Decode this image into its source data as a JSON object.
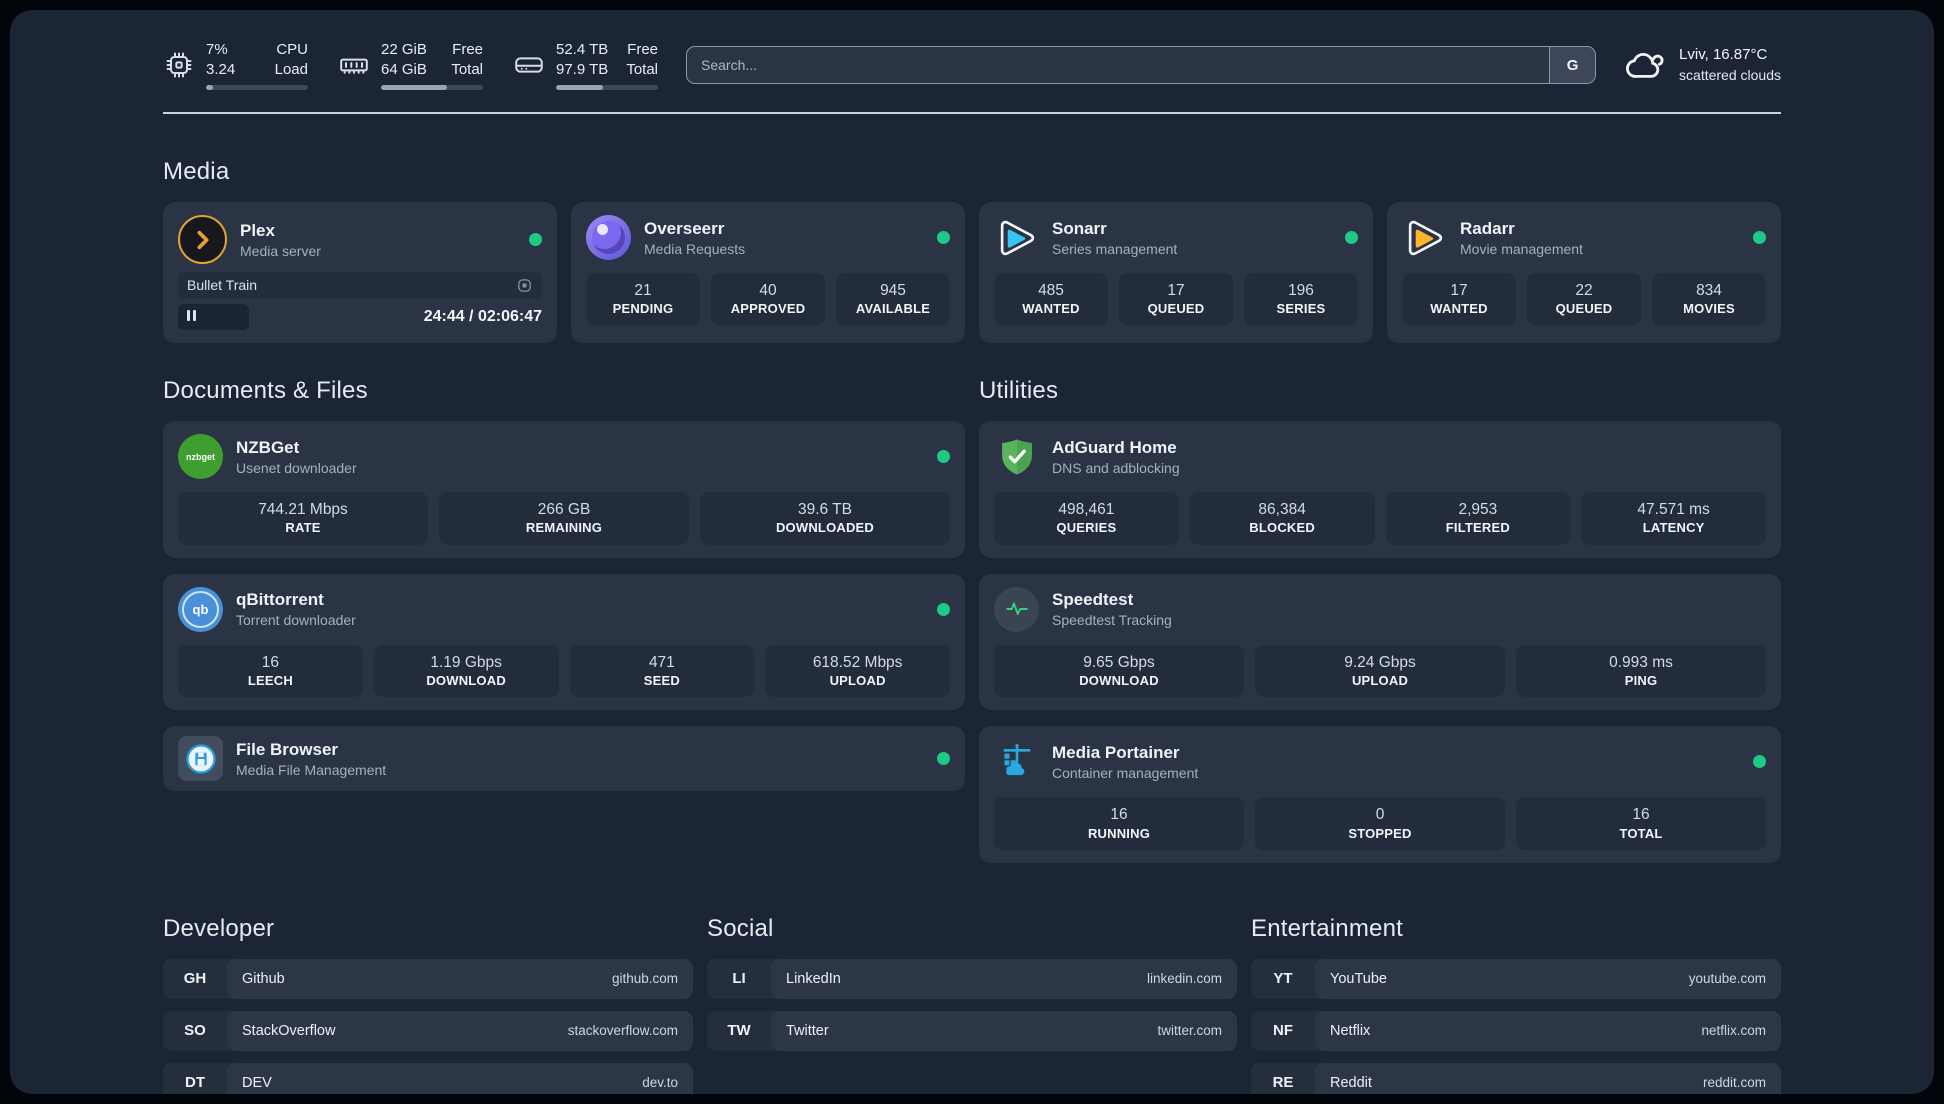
{
  "header": {
    "system_stats": [
      {
        "icon": "cpu-icon",
        "rows": [
          {
            "value": "7%",
            "label": "CPU"
          },
          {
            "value": "3.24",
            "label": "Load"
          }
        ],
        "progress_percent": 7
      },
      {
        "icon": "ram-icon",
        "rows": [
          {
            "value": "22 GiB",
            "label": "Free"
          },
          {
            "value": "64 GiB",
            "label": "Total"
          }
        ],
        "progress_percent": 65
      },
      {
        "icon": "disk-icon",
        "rows": [
          {
            "value": "52.4 TB",
            "label": "Free"
          },
          {
            "value": "97.9 TB",
            "label": "Total"
          }
        ],
        "progress_percent": 46
      }
    ],
    "search": {
      "placeholder": "Search...",
      "engine_button": "G"
    },
    "weather": {
      "location": "Lviv, 16.87°C",
      "condition": "scattered clouds"
    }
  },
  "media_section": {
    "title": "Media",
    "plex": {
      "name": "Plex",
      "description": "Media server",
      "now_playing": {
        "title": "Bullet Train",
        "time": "24:44 / 02:06:47",
        "progress_percent": 19.5,
        "state": "paused"
      }
    },
    "overseerr": {
      "name": "Overseerr",
      "description": "Media Requests",
      "stats": [
        {
          "value": "21",
          "label": "PENDING"
        },
        {
          "value": "40",
          "label": "APPROVED"
        },
        {
          "value": "945",
          "label": "AVAILABLE"
        }
      ]
    },
    "sonarr": {
      "name": "Sonarr",
      "description": "Series management",
      "stats": [
        {
          "value": "485",
          "label": "WANTED"
        },
        {
          "value": "17",
          "label": "QUEUED"
        },
        {
          "value": "196",
          "label": "SERIES"
        }
      ]
    },
    "radarr": {
      "name": "Radarr",
      "description": "Movie management",
      "stats": [
        {
          "value": "17",
          "label": "WANTED"
        },
        {
          "value": "22",
          "label": "QUEUED"
        },
        {
          "value": "834",
          "label": "MOVIES"
        }
      ]
    }
  },
  "documents_section": {
    "title": "Documents & Files",
    "nzbget": {
      "name": "NZBGet",
      "description": "Usenet downloader",
      "icon_text": "nzbget",
      "stats": [
        {
          "value": "744.21 Mbps",
          "label": "RATE"
        },
        {
          "value": "266 GB",
          "label": "REMAINING"
        },
        {
          "value": "39.6 TB",
          "label": "DOWNLOADED"
        }
      ]
    },
    "qbittorrent": {
      "name": "qBittorrent",
      "description": "Torrent downloader",
      "icon_text": "qb",
      "stats": [
        {
          "value": "16",
          "label": "LEECH"
        },
        {
          "value": "1.19 Gbps",
          "label": "DOWNLOAD"
        },
        {
          "value": "471",
          "label": "SEED"
        },
        {
          "value": "618.52 Mbps",
          "label": "UPLOAD"
        }
      ]
    },
    "filebrowser": {
      "name": "File Browser",
      "description": "Media File Management"
    }
  },
  "utilities_section": {
    "title": "Utilities",
    "adguard": {
      "name": "AdGuard Home",
      "description": "DNS and adblocking",
      "stats": [
        {
          "value": "498,461",
          "label": "QUERIES"
        },
        {
          "value": "86,384",
          "label": "BLOCKED"
        },
        {
          "value": "2,953",
          "label": "FILTERED"
        },
        {
          "value": "47.571 ms",
          "label": "LATENCY"
        }
      ]
    },
    "speedtest": {
      "name": "Speedtest",
      "description": "Speedtest Tracking",
      "stats": [
        {
          "value": "9.65 Gbps",
          "label": "DOWNLOAD"
        },
        {
          "value": "9.24 Gbps",
          "label": "UPLOAD"
        },
        {
          "value": "0.993 ms",
          "label": "PING"
        }
      ]
    },
    "portainer": {
      "name": "Media Portainer",
      "description": "Container management",
      "stats": [
        {
          "value": "16",
          "label": "RUNNING"
        },
        {
          "value": "0",
          "label": "STOPPED"
        },
        {
          "value": "16",
          "label": "TOTAL"
        }
      ]
    }
  },
  "bookmarks": {
    "developer": {
      "title": "Developer",
      "items": [
        {
          "abbrev": "GH",
          "name": "Github",
          "url": "github.com"
        },
        {
          "abbrev": "SO",
          "name": "StackOverflow",
          "url": "stackoverflow.com"
        },
        {
          "abbrev": "DT",
          "name": "DEV",
          "url": "dev.to"
        }
      ]
    },
    "social": {
      "title": "Social",
      "items": [
        {
          "abbrev": "LI",
          "name": "LinkedIn",
          "url": "linkedin.com"
        },
        {
          "abbrev": "TW",
          "name": "Twitter",
          "url": "twitter.com"
        }
      ]
    },
    "entertainment": {
      "title": "Entertainment",
      "items": [
        {
          "abbrev": "YT",
          "name": "YouTube",
          "url": "youtube.com"
        },
        {
          "abbrev": "NF",
          "name": "Netflix",
          "url": "netflix.com"
        },
        {
          "abbrev": "RE",
          "name": "Reddit",
          "url": "reddit.com"
        }
      ]
    }
  },
  "colors": {
    "status_online": "#1ec887",
    "plex_accent": "#e8a22c",
    "sonarr_accent": "#38c5f4",
    "radarr_accent": "#ffb32e"
  }
}
